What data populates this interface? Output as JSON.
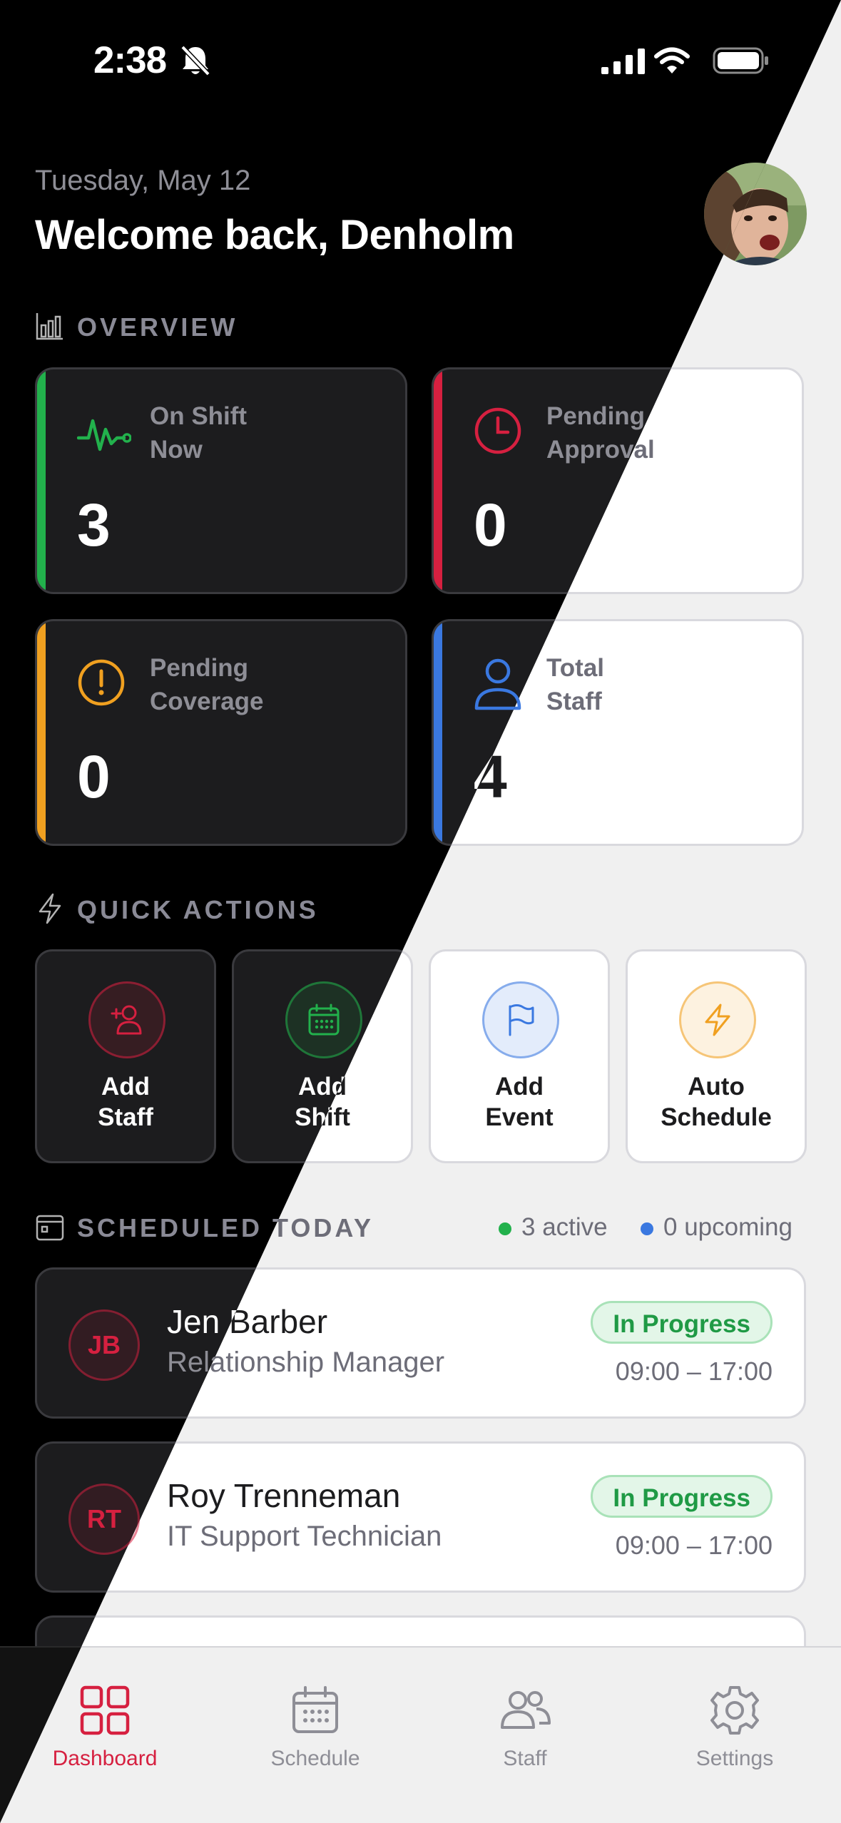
{
  "status": {
    "time": "2:38"
  },
  "header": {
    "date": "Tuesday, May 12",
    "welcome": "Welcome back, Denholm"
  },
  "overview": {
    "title": "OVERVIEW",
    "cards": [
      {
        "label_line1": "On Shift",
        "label_line2": "Now",
        "value": "3",
        "accent": "#22b14c",
        "icon": "activity-icon"
      },
      {
        "label_line1": "Pending",
        "label_line2": "Approval",
        "value": "0",
        "accent": "#d62040",
        "icon": "clock-icon"
      },
      {
        "label_line1": "Pending",
        "label_line2": "Coverage",
        "value": "0",
        "accent": "#f0a020",
        "icon": "alert-circle-icon"
      },
      {
        "label_line1": "Total",
        "label_line2": "Staff",
        "value": "4",
        "accent": "#3a78e0",
        "icon": "user-icon"
      }
    ]
  },
  "quick_actions": {
    "title": "QUICK ACTIONS",
    "items": [
      {
        "line1": "Add",
        "line2": "Staff",
        "color": "#d62040",
        "icon": "add-user-icon"
      },
      {
        "line1": "Add",
        "line2": "Shift",
        "color": "#22b14c",
        "icon": "calendar-icon"
      },
      {
        "line1": "Add",
        "line2": "Event",
        "color": "#3a78e0",
        "icon": "flag-icon"
      },
      {
        "line1": "Auto",
        "line2": "Schedule",
        "color": "#f0a020",
        "icon": "bolt-icon"
      }
    ]
  },
  "schedule": {
    "title": "SCHEDULED TODAY",
    "active": "3 active",
    "upcoming": "0 upcoming",
    "items": [
      {
        "initials": "JB",
        "name": "Jen Barber",
        "role": "Relationship Manager",
        "status": "In Progress",
        "time": "09:00 – 17:00"
      },
      {
        "initials": "RT",
        "name": "Roy Trenneman",
        "role": "IT Support Technician",
        "status": "In Progress",
        "time": "09:00 – 17:00"
      }
    ]
  },
  "tabs": [
    {
      "label": "Dashboard",
      "icon": "grid-icon",
      "active": true
    },
    {
      "label": "Schedule",
      "icon": "calendar-icon"
    },
    {
      "label": "Staff",
      "icon": "users-icon"
    },
    {
      "label": "Settings",
      "icon": "gear-icon"
    }
  ]
}
